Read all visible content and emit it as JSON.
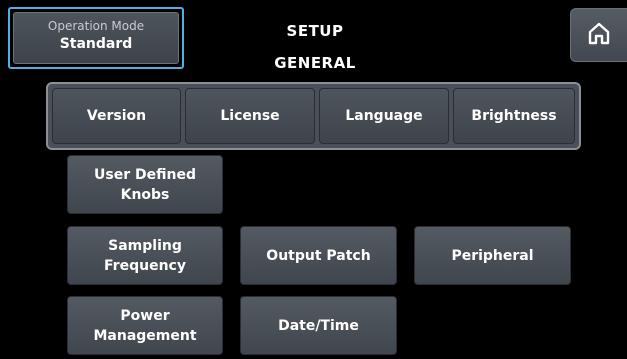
{
  "operation_mode": {
    "label": "Operation Mode",
    "value": "Standard"
  },
  "header": {
    "title": "SETUP",
    "subtitle": "GENERAL"
  },
  "home_icon": "home-icon",
  "tabs": [
    {
      "label": "Version"
    },
    {
      "label": "License"
    },
    {
      "label": "Language"
    },
    {
      "label": "Brightness"
    }
  ],
  "buttons": {
    "user_defined_knobs": "User Defined\nKnobs",
    "sampling_frequency": "Sampling\nFrequency",
    "output_patch": "Output Patch",
    "peripheral": "Peripheral",
    "power_management": "Power\nManagement",
    "date_time": "Date/Time"
  },
  "colors": {
    "background": "#000000",
    "button": "#4a5057",
    "selection_outline": "#4fb0e6"
  }
}
